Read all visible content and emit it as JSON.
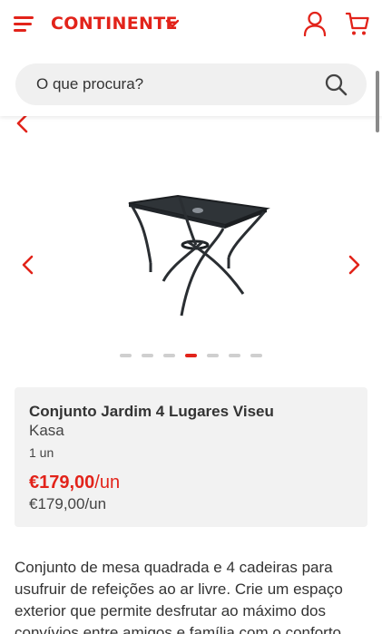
{
  "header": {
    "logo_text": "CONTINENTE",
    "brand_color": "#e2231a",
    "menu_icon": "hamburger-menu-icon",
    "user_icon": "user-icon",
    "cart_icon": "cart-icon"
  },
  "search": {
    "placeholder": "O que procura?",
    "icon": "search-icon"
  },
  "gallery": {
    "image_alt": "Mesa quadrada de jardim",
    "dot_count": 7,
    "active_dot": 4
  },
  "product": {
    "title": "Conjunto Jardim 4 Lugares Viseu",
    "brand": "Kasa",
    "quantity": "1 un",
    "price_main": "€179,00",
    "price_unit": "/un",
    "price_secondary": "€179,00/un"
  },
  "description": "Conjunto de mesa quadrada e 4 cadeiras para usufruir de refeições ao ar livre. Crie um espaço exterior que permite desfrutar ao máximo dos convívios entre amigos e família com o conforto"
}
